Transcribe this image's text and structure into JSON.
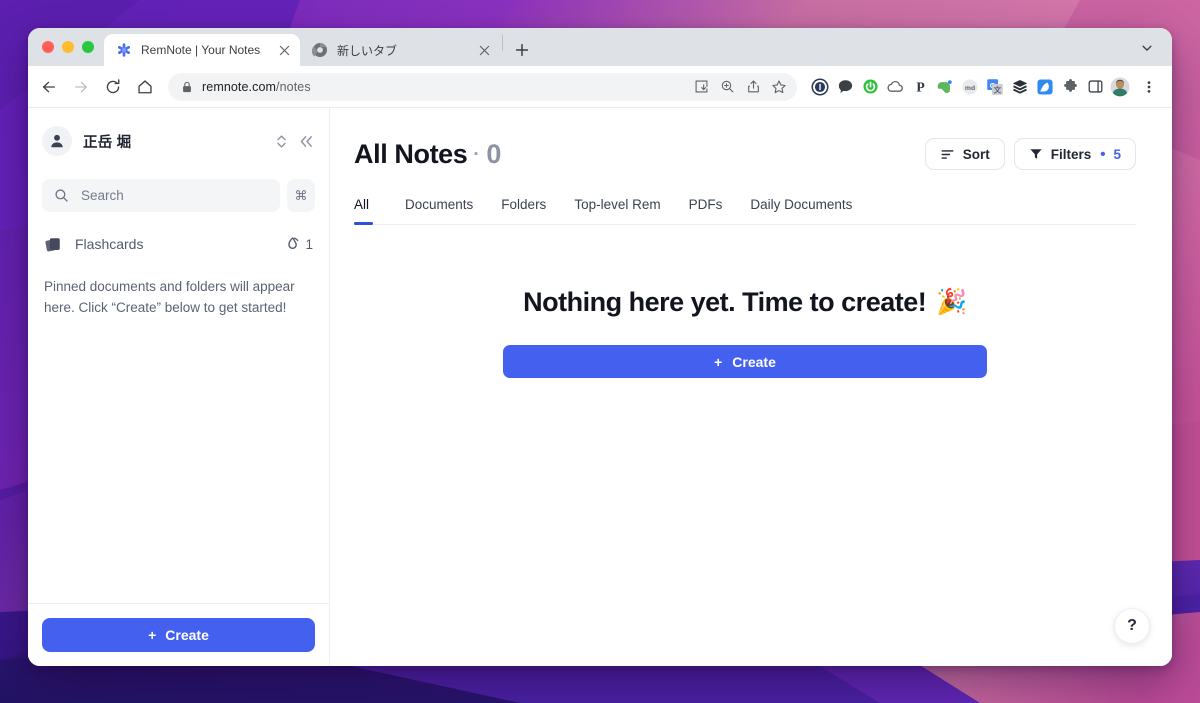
{
  "browser": {
    "traffic_lights": [
      "close",
      "minimize",
      "zoom"
    ],
    "tabs": [
      {
        "title": "RemNote | Your Notes",
        "favicon": "remnote-icon",
        "active": true,
        "close_label": "×"
      },
      {
        "title": "新しいタブ",
        "favicon": "chrome-icon",
        "active": false,
        "close_label": "×"
      }
    ],
    "new_tab_label": "+",
    "tab_search_label": "⌄",
    "nav": {
      "back": "←",
      "forward": "→",
      "reload": "↻",
      "home": "⌂"
    },
    "omnibox": {
      "lock": "lock-icon",
      "domain": "remnote.com",
      "path": "/notes",
      "actions": [
        "install-icon",
        "zoom-icon",
        "share-icon",
        "bookmark-star-icon"
      ]
    },
    "extensions": [
      {
        "name": "1password-extension",
        "color": "#2b3a5c"
      },
      {
        "name": "chat-extension",
        "color": "#3c4043"
      },
      {
        "name": "ublock-extension",
        "color": "#2ec13b"
      },
      {
        "name": "cloud-extension",
        "color": "#5f6368"
      },
      {
        "name": "pocket-extension",
        "color": "#2d3340"
      },
      {
        "name": "evernote-extension",
        "color": "#5bb85c"
      },
      {
        "name": "markdownload-extension",
        "color": "#6e7480"
      },
      {
        "name": "google-translate-extension",
        "color": "#4285f4"
      },
      {
        "name": "buffer-extension",
        "color": "#2a2f3a"
      },
      {
        "name": "kiwi-extension",
        "color": "#2f8bf0"
      },
      {
        "name": "puzzle-extensions-icon",
        "color": "#5f6368"
      },
      {
        "name": "side-panel-icon",
        "color": "#3c4043"
      },
      {
        "name": "profile-avatar",
        "color": "#2e7d6d"
      }
    ],
    "menu_label": "⋮"
  },
  "sidebar": {
    "user": {
      "name": "正岳 堀",
      "avatar_icon": "person-icon",
      "switcher_icon": "chevron-updown-icon",
      "collapse_icon": "collapse-left-icon"
    },
    "search": {
      "placeholder": "Search",
      "icon": "search-icon",
      "shortcut": "⌘"
    },
    "flashcards": {
      "label": "Flashcards",
      "icon": "cards-icon",
      "streak_icon": "flame-icon",
      "streak_count": "1"
    },
    "pinned_hint": "Pinned documents and folders will appear here. Click “Create” below to get started!",
    "create_button": {
      "label": "Create",
      "plus": "+"
    }
  },
  "main": {
    "title": "All Notes",
    "title_separator": "·",
    "count": "0",
    "sort_button": {
      "label": "Sort",
      "icon": "sort-icon"
    },
    "filters_button": {
      "label": "Filters",
      "icon": "filter-icon",
      "dot": "•",
      "count": "5"
    },
    "tabs": [
      {
        "label": "All",
        "active": true
      },
      {
        "label": "Documents",
        "active": false
      },
      {
        "label": "Folders",
        "active": false
      },
      {
        "label": "Top-level Rem",
        "active": false
      },
      {
        "label": "PDFs",
        "active": false
      },
      {
        "label": "Daily Documents",
        "active": false
      }
    ],
    "empty_state": {
      "title": "Nothing here yet. Time to create!",
      "emoji": "🎉",
      "create_button": {
        "label": "Create",
        "plus": "+"
      }
    },
    "help_button": {
      "label": "?"
    }
  },
  "colors": {
    "accent_blue": "#4361ee",
    "tab_underline": "#2f4fe0",
    "sidebar_border": "#eceef1",
    "wallpaper_purple": "#5b21b6",
    "wallpaper_pink": "#d96aa8"
  }
}
